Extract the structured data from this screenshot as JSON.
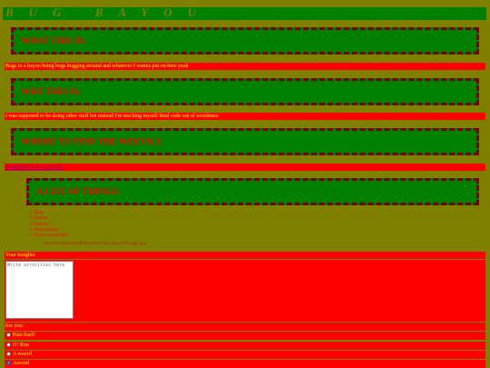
{
  "site": {
    "title": "BUG BAYOU"
  },
  "sections": {
    "what": {
      "heading": "WHAT THIS IS:",
      "text": "Bugs in a bayou being bugs bugging around and whatever I wanna put on here yeah"
    },
    "why": {
      "heading": "WHY THIS IS:",
      "text": "I was supposed to be doing other stuff but instead I'm teaching myself html code out of avoidence"
    },
    "where": {
      "heading": "WHERE TO FIND THE WEEVILS",
      "link": "Mudpuddle Pool Crossing"
    },
    "list": {
      "heading": "A LIST OF THINGS:",
      "items": [
        "1. Bugs",
        "2. Bayous",
        "3. Weevils",
        "4. Mud puddles",
        "5. More mud puddles"
      ],
      "faint_note": "We wear white scruffed cowboy hat, dusky dot bags gun"
    }
  },
  "form": {
    "insights_label": "Your insights:",
    "textarea_placeholder": "Write atrocities here",
    "question": "Are you:",
    "options": [
      {
        "label": "Pain Itself",
        "checked": false
      },
      {
        "label": "O! Ron",
        "checked": false
      },
      {
        "label": "A weevil",
        "checked": false
      },
      {
        "label": "Anvoid",
        "checked": true
      }
    ]
  },
  "colors": {
    "background": "#808000",
    "header_box": "#008000",
    "accent": "#ff0000",
    "text_on_red": "#ffff00",
    "link": "#800080"
  }
}
